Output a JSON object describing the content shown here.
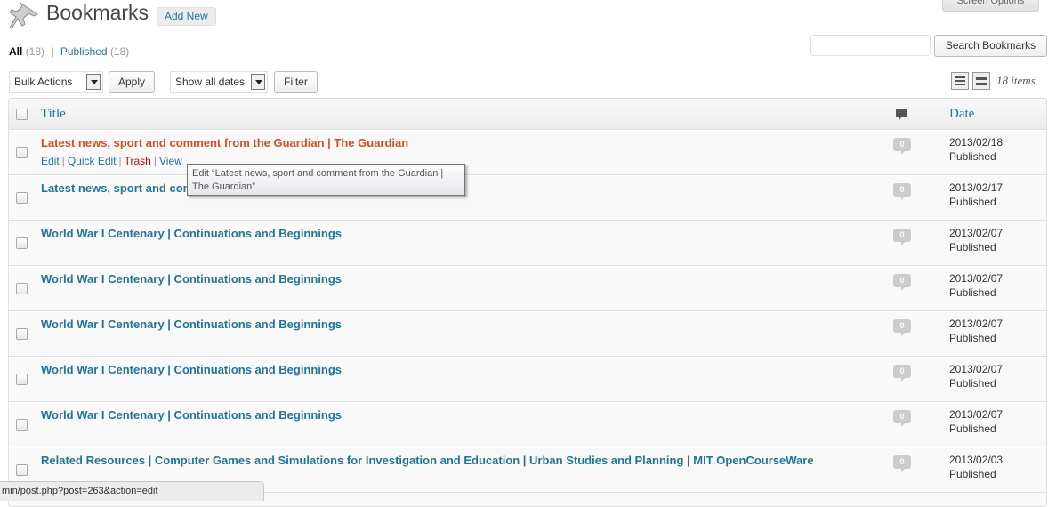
{
  "header": {
    "title": "Bookmarks",
    "add_new": "Add New",
    "screen_options": "Screen Options"
  },
  "filters": {
    "all_label": "All",
    "all_count": "(18)",
    "separator": "|",
    "published_label": "Published",
    "published_count": "(18)"
  },
  "search": {
    "value": "",
    "button": "Search Bookmarks"
  },
  "tablenav": {
    "bulk_actions": "Bulk Actions",
    "apply": "Apply",
    "dates": "Show all dates",
    "filter": "Filter",
    "items_count": "18 items"
  },
  "table": {
    "columns": {
      "title": "Title",
      "date": "Date"
    },
    "rows": [
      {
        "title": "Latest news, sport and comment from the Guardian | The Guardian",
        "comments": "0",
        "date": "2013/02/18",
        "status": "Published"
      },
      {
        "title": "Latest news, sport and comment from the Guardian | The Guardian",
        "comments": "0",
        "date": "2013/02/17",
        "status": "Published"
      },
      {
        "title": "World War I Centenary | Continuations and Beginnings",
        "comments": "0",
        "date": "2013/02/07",
        "status": "Published"
      },
      {
        "title": "World War I Centenary | Continuations and Beginnings",
        "comments": "0",
        "date": "2013/02/07",
        "status": "Published"
      },
      {
        "title": "World War I Centenary | Continuations and Beginnings",
        "comments": "0",
        "date": "2013/02/07",
        "status": "Published"
      },
      {
        "title": "World War I Centenary | Continuations and Beginnings",
        "comments": "0",
        "date": "2013/02/07",
        "status": "Published"
      },
      {
        "title": "World War I Centenary | Continuations and Beginnings",
        "comments": "0",
        "date": "2013/02/07",
        "status": "Published"
      },
      {
        "title": "Related Resources | Computer Games and Simulations for Investigation and Education | Urban Studies and Planning | MIT OpenCourseWare",
        "comments": "0",
        "date": "2013/02/03",
        "status": "Published"
      }
    ]
  },
  "row_actions": {
    "edit": "Edit",
    "quick_edit": "Quick Edit",
    "trash": "Trash",
    "view": "View",
    "sep": "|"
  },
  "tooltip": {
    "text": "Edit “Latest news, sport and comment from the Guardian | The Guardian”"
  },
  "status_bar": {
    "url": "min/post.php?post=263&action=edit"
  },
  "colors": {
    "link": "#21759b",
    "link_hover": "#d54e21",
    "trash": "#bc0b0b"
  }
}
